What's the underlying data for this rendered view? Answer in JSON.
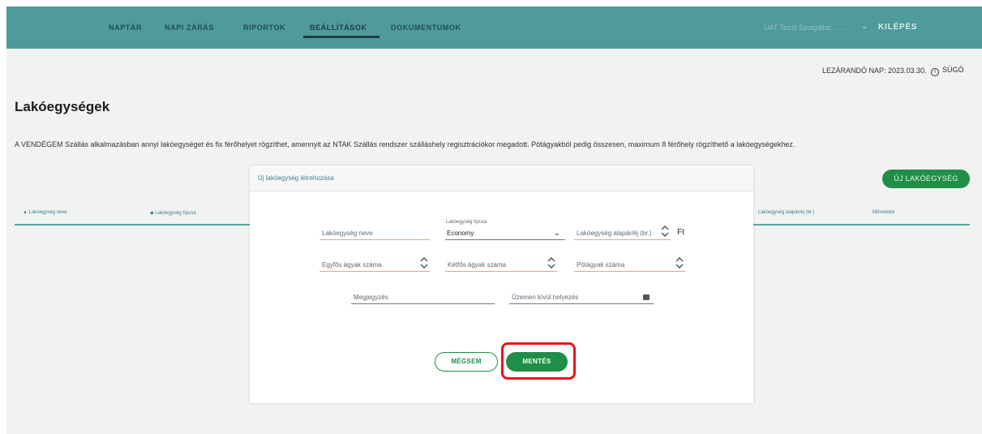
{
  "nav": {
    "items": [
      "NAPTÁR",
      "NAPI ZÁRÁS",
      "RIPORTOK",
      "BEÁLLÍTÁSOK",
      "DOKUMENTUMOK"
    ],
    "active_index": 3,
    "user": "UAT Teszt Szolgáltat... - ...",
    "logout": "KILÉPÉS"
  },
  "header": {
    "closing_day": "LEZÁRANDÓ NAP: 2023.03.30.",
    "help": "SÚGÓ"
  },
  "page": {
    "title": "Lakóegységek",
    "description": "A VENDÉGEM Szállás alkalmazásban annyi lakóegységet és fix férőhelyet rögzíthet, amennyit az NTAK Szállás rendszer szálláshely regisztrációkor megadott. Pótágyakból pedig összesen, maximum 8 férőhely rögzíthető a lakóegységekhez.",
    "new_button": "ÚJ LAKÓEGYSÉG"
  },
  "table": {
    "columns": [
      "Lakóegység neve",
      "Lakóegység típusa",
      "Lakóegység alapár/éj (br.)",
      "Műveletek"
    ]
  },
  "modal": {
    "title": "Új lakóegység létrehozása",
    "fields": {
      "name": {
        "placeholder": "Lakóegység neve"
      },
      "type": {
        "label": "Lakóegység típusa",
        "value": "Economy"
      },
      "base_price": {
        "placeholder": "Lakóegység alapár/éj (br.)",
        "unit": "Ft"
      },
      "single_beds": {
        "placeholder": "Egyfős ágyak száma"
      },
      "double_beds": {
        "placeholder": "Kétfős ágyak száma"
      },
      "extra_beds": {
        "placeholder": "Pótágyak száma"
      },
      "note": {
        "placeholder": "Megjegyzés"
      },
      "out_of_service": {
        "placeholder": "Üzemen kívül helyezés"
      }
    },
    "cancel": "MÉGSEM",
    "save": "MENTÉS"
  },
  "colors": {
    "nav_bg": "#4f9a9a",
    "primary_green": "#1f8f47",
    "highlight_red": "#e8141b"
  }
}
